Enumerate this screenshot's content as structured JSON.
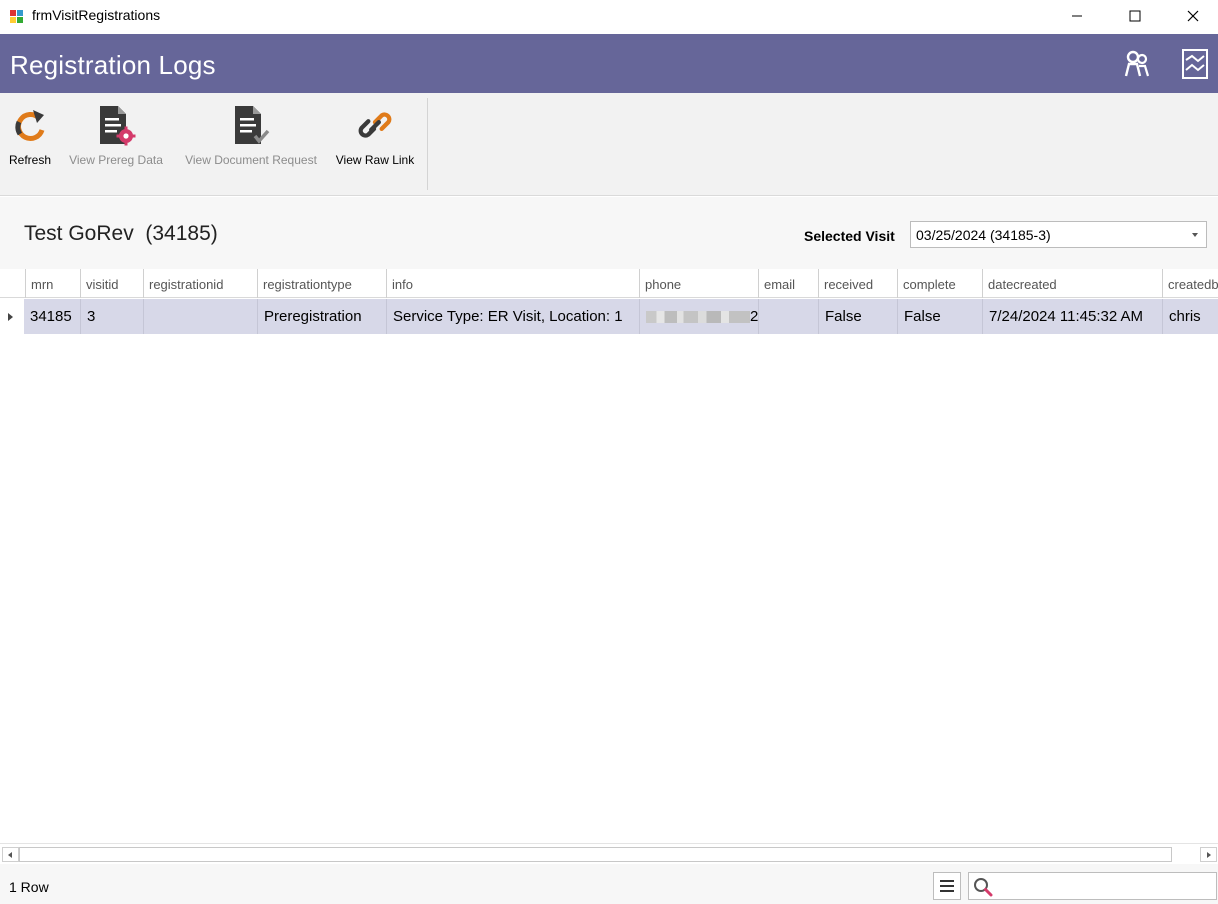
{
  "window": {
    "title": "frmVisitRegistrations"
  },
  "header": {
    "title": "Registration Logs",
    "background_color": "#666699",
    "icons": [
      "users-icon",
      "chart-icon"
    ]
  },
  "toolbar": {
    "buttons": [
      {
        "label": "Refresh",
        "icon": "refresh-icon",
        "enabled": true
      },
      {
        "label": "View Prereg Data",
        "icon": "document-gear-icon",
        "enabled": false
      },
      {
        "label": "View Document Request",
        "icon": "document-check-icon",
        "enabled": false
      },
      {
        "label": "View Raw Link",
        "icon": "link-icon",
        "enabled": true
      }
    ]
  },
  "patient": {
    "name": "Test GoRev  (34185)"
  },
  "visit_selector": {
    "label": "Selected Visit",
    "value": "03/25/2024 (34185-3)"
  },
  "grid": {
    "columns": [
      "mrn",
      "visitid",
      "registrationid",
      "registrationtype",
      "info",
      "phone",
      "email",
      "received",
      "complete",
      "datecreated",
      "createdb"
    ],
    "rows": [
      {
        "mrn": "34185",
        "visitid": "3",
        "registrationid": "",
        "registrationtype": "Preregistration",
        "info": "Service Type: ER Visit, Location: 1",
        "phone_visible_suffix": "2",
        "email": "",
        "received": "False",
        "complete": "False",
        "datecreated": "7/24/2024 11:45:32 AM",
        "createdby": "chris"
      }
    ]
  },
  "status": {
    "row_count": "1 Row",
    "search_value": ""
  },
  "colors": {
    "selected_row": "#d7d8e8",
    "refresh_orange": "#e07b1a",
    "gear_pink": "#d43a6a",
    "link_orange": "#e07b1a"
  }
}
